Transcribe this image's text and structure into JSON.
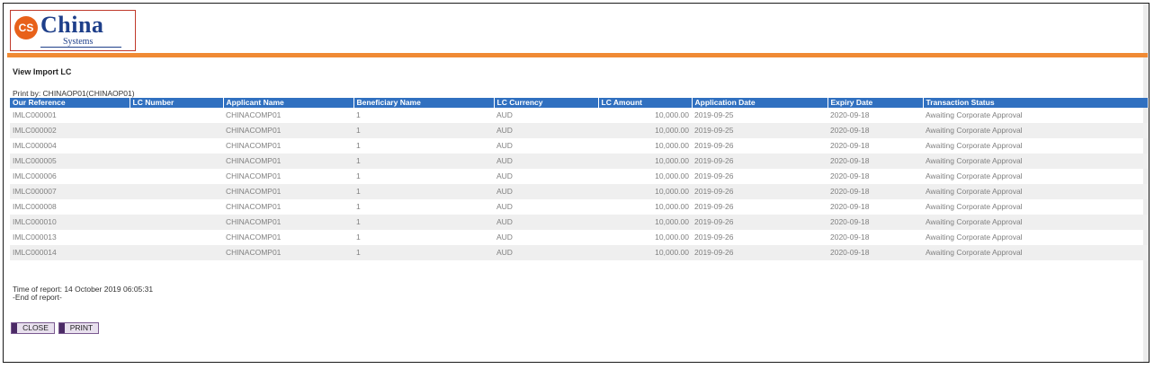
{
  "logo": {
    "badge": "CS",
    "name": "China",
    "sub": "Systems"
  },
  "page": {
    "title": "View Import LC",
    "print_by": "Print by: CHINAOP01(CHINAOP01)"
  },
  "table": {
    "headers": [
      "Our Reference",
      "LC Number",
      "Applicant Name",
      "Beneficiary Name",
      "LC Currency",
      "LC Amount",
      "Application Date",
      "Expiry Date",
      "Transaction Status"
    ],
    "rows": [
      [
        "IMLC000001",
        "",
        "CHINACOMP01",
        "1",
        "AUD",
        "10,000.00",
        "2019-09-25",
        "2020-09-18",
        "Awaiting Corporate Approval"
      ],
      [
        "IMLC000002",
        "",
        "CHINACOMP01",
        "1",
        "AUD",
        "10,000.00",
        "2019-09-25",
        "2020-09-18",
        "Awaiting Corporate Approval"
      ],
      [
        "IMLC000004",
        "",
        "CHINACOMP01",
        "1",
        "AUD",
        "10,000.00",
        "2019-09-26",
        "2020-09-18",
        "Awaiting Corporate Approval"
      ],
      [
        "IMLC000005",
        "",
        "CHINACOMP01",
        "1",
        "AUD",
        "10,000.00",
        "2019-09-26",
        "2020-09-18",
        "Awaiting Corporate Approval"
      ],
      [
        "IMLC000006",
        "",
        "CHINACOMP01",
        "1",
        "AUD",
        "10,000.00",
        "2019-09-26",
        "2020-09-18",
        "Awaiting Corporate Approval"
      ],
      [
        "IMLC000007",
        "",
        "CHINACOMP01",
        "1",
        "AUD",
        "10,000.00",
        "2019-09-26",
        "2020-09-18",
        "Awaiting Corporate Approval"
      ],
      [
        "IMLC000008",
        "",
        "CHINACOMP01",
        "1",
        "AUD",
        "10,000.00",
        "2019-09-26",
        "2020-09-18",
        "Awaiting Corporate Approval"
      ],
      [
        "IMLC000010",
        "",
        "CHINACOMP01",
        "1",
        "AUD",
        "10,000.00",
        "2019-09-26",
        "2020-09-18",
        "Awaiting Corporate Approval"
      ],
      [
        "IMLC000013",
        "",
        "CHINACOMP01",
        "1",
        "AUD",
        "10,000.00",
        "2019-09-26",
        "2020-09-18",
        "Awaiting Corporate Approval"
      ],
      [
        "IMLC000014",
        "",
        "CHINACOMP01",
        "1",
        "AUD",
        "10,000.00",
        "2019-09-26",
        "2020-09-18",
        "Awaiting Corporate Approval"
      ]
    ]
  },
  "footer": {
    "time_of_report": "Time of report: 14 October 2019 06:05:31",
    "end_of_report": "-End of report-"
  },
  "buttons": {
    "close_label": "CLOSE",
    "print_label": "PRINT"
  },
  "colors": {
    "accent_bar": "#f08a34",
    "header_bg": "#3070c0",
    "logo_blue": "#1e3f8a",
    "logo_border": "#c0392b",
    "button_mark": "#4b2a66"
  }
}
